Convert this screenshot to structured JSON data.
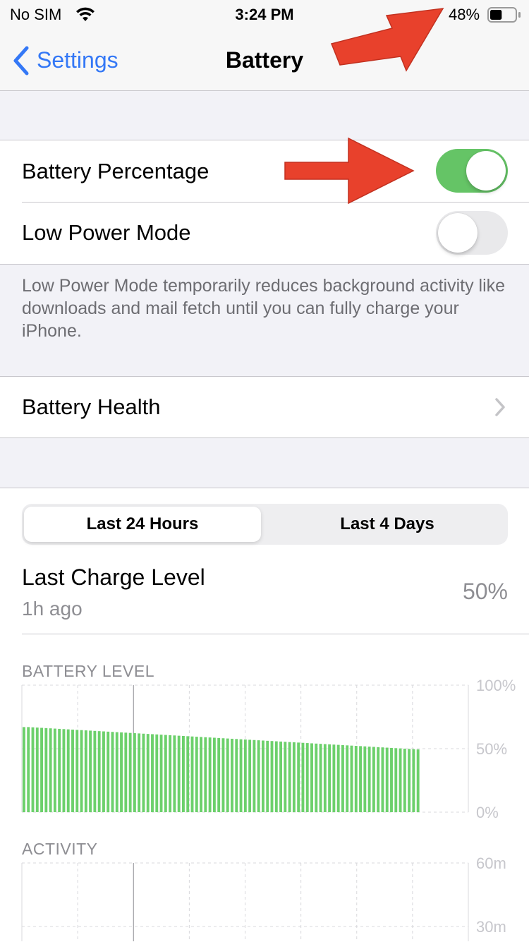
{
  "status_bar": {
    "carrier": "No SIM",
    "time": "3:24 PM",
    "battery_percent": "48%",
    "battery_fill_fraction": 0.48
  },
  "nav": {
    "back_label": "Settings",
    "title": "Battery"
  },
  "settings": {
    "battery_percentage": {
      "label": "Battery Percentage",
      "enabled": true
    },
    "low_power_mode": {
      "label": "Low Power Mode",
      "enabled": false
    },
    "low_power_note": "Low Power Mode temporarily reduces background activity like downloads and mail fetch until you can fully charge your iPhone.",
    "battery_health": {
      "label": "Battery Health"
    }
  },
  "usage": {
    "tabs": [
      {
        "label": "Last 24 Hours",
        "selected": true
      },
      {
        "label": "Last 4 Days",
        "selected": false
      }
    ],
    "last_charge": {
      "label": "Last Charge Level",
      "time": "1h ago",
      "value": "50%"
    }
  },
  "colors": {
    "accent": "#3478f6",
    "toggle_on": "#65c466",
    "bar": "#6cd06b",
    "annotation_arrow": "#e8412c"
  },
  "chart_data": [
    {
      "type": "bar",
      "title": "BATTERY LEVEL",
      "y_ticks": [
        "100%",
        "50%",
        "0%"
      ],
      "ylim": [
        0,
        100
      ],
      "values": [
        67,
        67,
        66.8,
        66.6,
        66.4,
        66.2,
        66,
        65.8,
        65.6,
        65.4,
        65.2,
        65,
        64.8,
        64.6,
        64.4,
        64.2,
        64,
        63.8,
        63.6,
        63.4,
        63.2,
        63,
        62.8,
        62.6,
        62.4,
        62.2,
        62,
        61.8,
        61.6,
        61.4,
        61.2,
        61,
        60.8,
        60.6,
        60.4,
        60.2,
        60,
        59.8,
        59.6,
        59.4,
        59.2,
        59,
        58.8,
        58.6,
        58.4,
        58.2,
        58,
        57.8,
        57.6,
        57.4,
        57.2,
        57,
        56.8,
        56.6,
        56.4,
        56.2,
        56,
        55.8,
        55.6,
        55.4,
        55.2,
        55,
        54.8,
        54.6,
        54.4,
        54.2,
        54,
        53.8,
        53.6,
        53.4,
        53.2,
        53,
        52.8,
        52.6,
        52.4,
        52.2,
        52,
        51.8,
        51.6,
        51.4,
        51.2,
        51,
        50.8,
        50.6,
        50.4,
        50.2,
        50,
        49.8,
        49.6,
        49.4
      ],
      "grid": true
    },
    {
      "type": "bar",
      "title": "ACTIVITY",
      "y_ticks": [
        "60m",
        "30m"
      ],
      "ylim": [
        0,
        60
      ],
      "values": [],
      "grid": true
    }
  ]
}
